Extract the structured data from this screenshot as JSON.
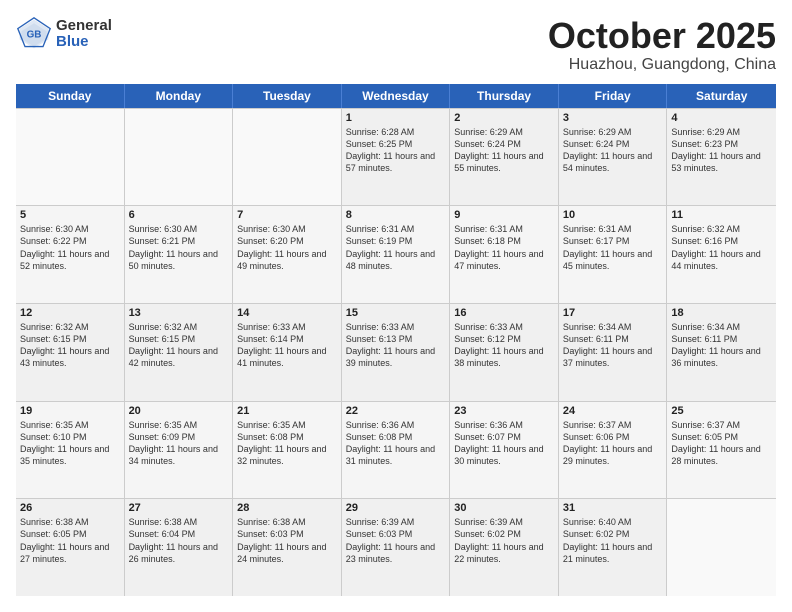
{
  "logo": {
    "general": "General",
    "blue": "Blue"
  },
  "title": "October 2025",
  "location": "Huazhou, Guangdong, China",
  "days_of_week": [
    "Sunday",
    "Monday",
    "Tuesday",
    "Wednesday",
    "Thursday",
    "Friday",
    "Saturday"
  ],
  "weeks": [
    [
      {
        "day": "",
        "sunrise": "",
        "sunset": "",
        "daylight": "",
        "empty": true
      },
      {
        "day": "",
        "sunrise": "",
        "sunset": "",
        "daylight": "",
        "empty": true
      },
      {
        "day": "",
        "sunrise": "",
        "sunset": "",
        "daylight": "",
        "empty": true
      },
      {
        "day": "1",
        "sunrise": "Sunrise: 6:28 AM",
        "sunset": "Sunset: 6:25 PM",
        "daylight": "Daylight: 11 hours and 57 minutes."
      },
      {
        "day": "2",
        "sunrise": "Sunrise: 6:29 AM",
        "sunset": "Sunset: 6:24 PM",
        "daylight": "Daylight: 11 hours and 55 minutes."
      },
      {
        "day": "3",
        "sunrise": "Sunrise: 6:29 AM",
        "sunset": "Sunset: 6:24 PM",
        "daylight": "Daylight: 11 hours and 54 minutes."
      },
      {
        "day": "4",
        "sunrise": "Sunrise: 6:29 AM",
        "sunset": "Sunset: 6:23 PM",
        "daylight": "Daylight: 11 hours and 53 minutes."
      }
    ],
    [
      {
        "day": "5",
        "sunrise": "Sunrise: 6:30 AM",
        "sunset": "Sunset: 6:22 PM",
        "daylight": "Daylight: 11 hours and 52 minutes."
      },
      {
        "day": "6",
        "sunrise": "Sunrise: 6:30 AM",
        "sunset": "Sunset: 6:21 PM",
        "daylight": "Daylight: 11 hours and 50 minutes."
      },
      {
        "day": "7",
        "sunrise": "Sunrise: 6:30 AM",
        "sunset": "Sunset: 6:20 PM",
        "daylight": "Daylight: 11 hours and 49 minutes."
      },
      {
        "day": "8",
        "sunrise": "Sunrise: 6:31 AM",
        "sunset": "Sunset: 6:19 PM",
        "daylight": "Daylight: 11 hours and 48 minutes."
      },
      {
        "day": "9",
        "sunrise": "Sunrise: 6:31 AM",
        "sunset": "Sunset: 6:18 PM",
        "daylight": "Daylight: 11 hours and 47 minutes."
      },
      {
        "day": "10",
        "sunrise": "Sunrise: 6:31 AM",
        "sunset": "Sunset: 6:17 PM",
        "daylight": "Daylight: 11 hours and 45 minutes."
      },
      {
        "day": "11",
        "sunrise": "Sunrise: 6:32 AM",
        "sunset": "Sunset: 6:16 PM",
        "daylight": "Daylight: 11 hours and 44 minutes."
      }
    ],
    [
      {
        "day": "12",
        "sunrise": "Sunrise: 6:32 AM",
        "sunset": "Sunset: 6:15 PM",
        "daylight": "Daylight: 11 hours and 43 minutes."
      },
      {
        "day": "13",
        "sunrise": "Sunrise: 6:32 AM",
        "sunset": "Sunset: 6:15 PM",
        "daylight": "Daylight: 11 hours and 42 minutes."
      },
      {
        "day": "14",
        "sunrise": "Sunrise: 6:33 AM",
        "sunset": "Sunset: 6:14 PM",
        "daylight": "Daylight: 11 hours and 41 minutes."
      },
      {
        "day": "15",
        "sunrise": "Sunrise: 6:33 AM",
        "sunset": "Sunset: 6:13 PM",
        "daylight": "Daylight: 11 hours and 39 minutes."
      },
      {
        "day": "16",
        "sunrise": "Sunrise: 6:33 AM",
        "sunset": "Sunset: 6:12 PM",
        "daylight": "Daylight: 11 hours and 38 minutes."
      },
      {
        "day": "17",
        "sunrise": "Sunrise: 6:34 AM",
        "sunset": "Sunset: 6:11 PM",
        "daylight": "Daylight: 11 hours and 37 minutes."
      },
      {
        "day": "18",
        "sunrise": "Sunrise: 6:34 AM",
        "sunset": "Sunset: 6:11 PM",
        "daylight": "Daylight: 11 hours and 36 minutes."
      }
    ],
    [
      {
        "day": "19",
        "sunrise": "Sunrise: 6:35 AM",
        "sunset": "Sunset: 6:10 PM",
        "daylight": "Daylight: 11 hours and 35 minutes."
      },
      {
        "day": "20",
        "sunrise": "Sunrise: 6:35 AM",
        "sunset": "Sunset: 6:09 PM",
        "daylight": "Daylight: 11 hours and 34 minutes."
      },
      {
        "day": "21",
        "sunrise": "Sunrise: 6:35 AM",
        "sunset": "Sunset: 6:08 PM",
        "daylight": "Daylight: 11 hours and 32 minutes."
      },
      {
        "day": "22",
        "sunrise": "Sunrise: 6:36 AM",
        "sunset": "Sunset: 6:08 PM",
        "daylight": "Daylight: 11 hours and 31 minutes."
      },
      {
        "day": "23",
        "sunrise": "Sunrise: 6:36 AM",
        "sunset": "Sunset: 6:07 PM",
        "daylight": "Daylight: 11 hours and 30 minutes."
      },
      {
        "day": "24",
        "sunrise": "Sunrise: 6:37 AM",
        "sunset": "Sunset: 6:06 PM",
        "daylight": "Daylight: 11 hours and 29 minutes."
      },
      {
        "day": "25",
        "sunrise": "Sunrise: 6:37 AM",
        "sunset": "Sunset: 6:05 PM",
        "daylight": "Daylight: 11 hours and 28 minutes."
      }
    ],
    [
      {
        "day": "26",
        "sunrise": "Sunrise: 6:38 AM",
        "sunset": "Sunset: 6:05 PM",
        "daylight": "Daylight: 11 hours and 27 minutes."
      },
      {
        "day": "27",
        "sunrise": "Sunrise: 6:38 AM",
        "sunset": "Sunset: 6:04 PM",
        "daylight": "Daylight: 11 hours and 26 minutes."
      },
      {
        "day": "28",
        "sunrise": "Sunrise: 6:38 AM",
        "sunset": "Sunset: 6:03 PM",
        "daylight": "Daylight: 11 hours and 24 minutes."
      },
      {
        "day": "29",
        "sunrise": "Sunrise: 6:39 AM",
        "sunset": "Sunset: 6:03 PM",
        "daylight": "Daylight: 11 hours and 23 minutes."
      },
      {
        "day": "30",
        "sunrise": "Sunrise: 6:39 AM",
        "sunset": "Sunset: 6:02 PM",
        "daylight": "Daylight: 11 hours and 22 minutes."
      },
      {
        "day": "31",
        "sunrise": "Sunrise: 6:40 AM",
        "sunset": "Sunset: 6:02 PM",
        "daylight": "Daylight: 11 hours and 21 minutes."
      },
      {
        "day": "",
        "sunrise": "",
        "sunset": "",
        "daylight": "",
        "empty": true
      }
    ]
  ]
}
